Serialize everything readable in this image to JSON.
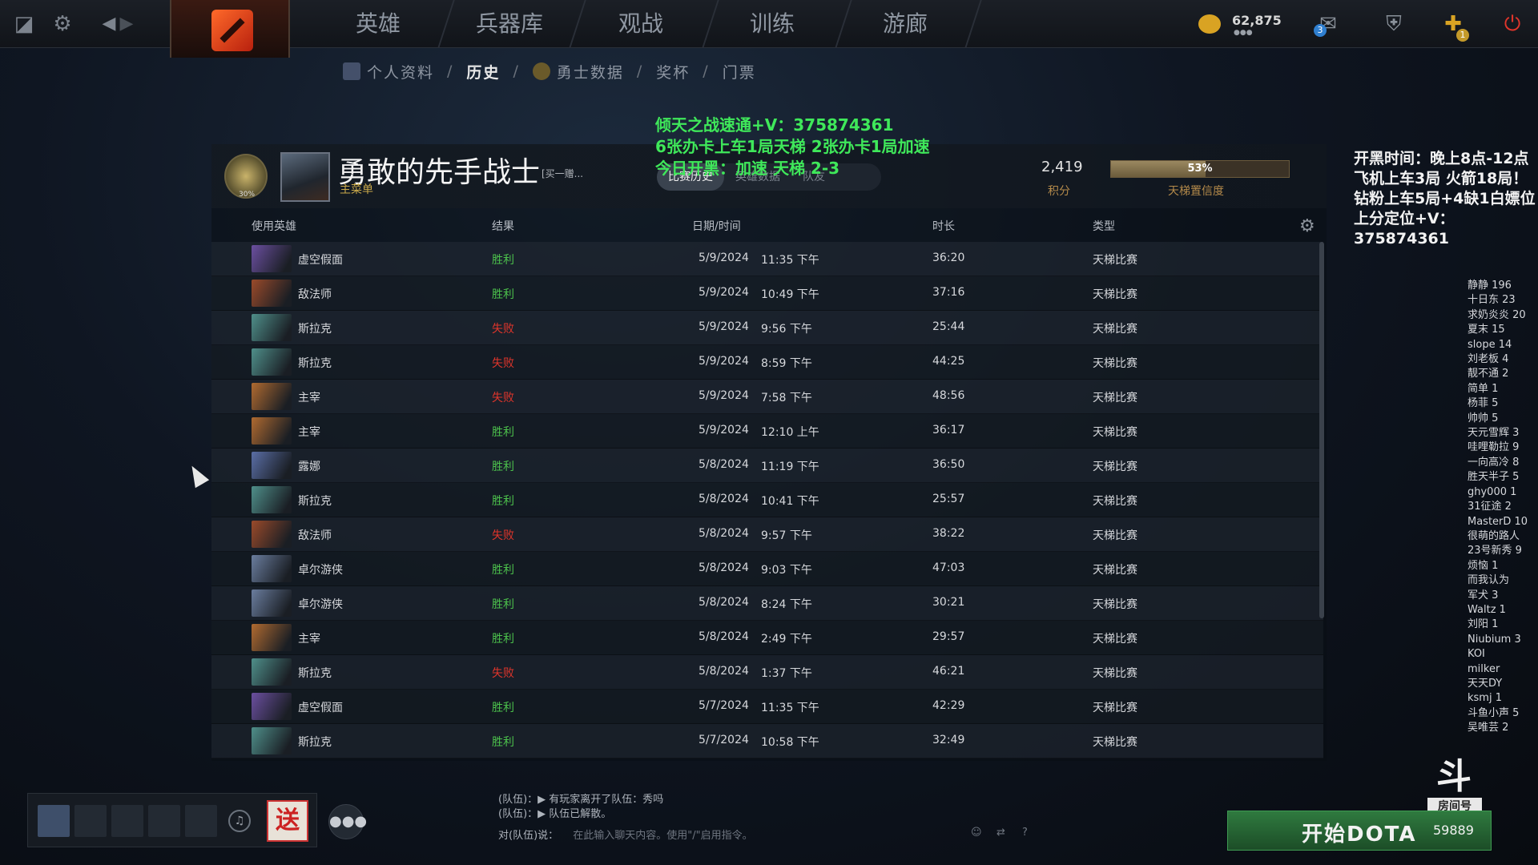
{
  "topbar": {
    "nav": [
      "英雄",
      "兵器库",
      "观战",
      "训练",
      "游廊"
    ],
    "coins": "62,875",
    "mail_badge": "3",
    "plus_badge": "1"
  },
  "breadcrumb": {
    "items": [
      "个人资料",
      "历史",
      "勇士数据",
      "奖杯",
      "门票"
    ],
    "active": "历史"
  },
  "overlay": {
    "green_lines": [
      "倾天之战速通+V：375874361",
      "6张办卡上车1局天梯  2张办卡1局加速",
      "今日开黑：加速  天梯 2-3"
    ],
    "right_lines": [
      "开黑时间：晚上8点-12点",
      "飞机上车3局  火箭18局！",
      "钻粉上车5局+4缺1白嫖位",
      "上分定位+V：375874361"
    ],
    "fans": [
      "静静 196",
      "十日东 23",
      "求奶炎炎 20",
      "夏末 15",
      "slope 14",
      "刘老板 4",
      "靓不通 2",
      "简单 1",
      "杨菲 5",
      "帅帅 5",
      "天元雪辉 3",
      "哇哩勒拉 9",
      "一向高冷 8",
      "胜天半子 5",
      "ghy000  1",
      "31征途  2",
      "MasterD 10",
      "很萌的路人",
      "23号新秀 9",
      "烦恼 1",
      "而我认为",
      "军犬 3",
      "Waltz  1",
      "刘阳 1",
      "Niubium 3",
      "KOI",
      "milker",
      "天天DY",
      "ksmj  1",
      "斗鱼小声 5",
      "吴唯芸 2"
    ]
  },
  "profile": {
    "medal_num": "30%",
    "name": "勇敢的先手战士",
    "tag": "[买一赠...",
    "subtitle": "主菜单",
    "tabs": [
      "比赛历史",
      "英雄数据",
      "队友"
    ],
    "active_tab": "比赛历史",
    "score": "2,419",
    "score_label": "积分",
    "confidence": "53%",
    "confidence_value": 0.53,
    "confidence_label": "天梯置信度"
  },
  "table": {
    "headers": [
      "使用英雄",
      "结果",
      "日期/时间",
      "时长",
      "类型"
    ],
    "rows": [
      {
        "hero": "虚空假面",
        "result": "胜利",
        "date": "5/9/2024",
        "time": "11:35 下午",
        "duration": "36:20",
        "type": "天梯比赛",
        "color": "#6b4fa0"
      },
      {
        "hero": "敌法师",
        "result": "胜利",
        "date": "5/9/2024",
        "time": "10:49 下午",
        "duration": "37:16",
        "type": "天梯比赛",
        "color": "#9a4a2a"
      },
      {
        "hero": "斯拉克",
        "result": "失败",
        "date": "5/9/2024",
        "time": "9:56 下午",
        "duration": "25:44",
        "type": "天梯比赛",
        "color": "#4f8f8a"
      },
      {
        "hero": "斯拉克",
        "result": "失败",
        "date": "5/9/2024",
        "time": "8:59 下午",
        "duration": "44:25",
        "type": "天梯比赛",
        "color": "#4f8f8a"
      },
      {
        "hero": "主宰",
        "result": "失败",
        "date": "5/9/2024",
        "time": "7:58 下午",
        "duration": "48:56",
        "type": "天梯比赛",
        "color": "#b06a30"
      },
      {
        "hero": "主宰",
        "result": "胜利",
        "date": "5/9/2024",
        "time": "12:10 上午",
        "duration": "36:17",
        "type": "天梯比赛",
        "color": "#b06a30"
      },
      {
        "hero": "露娜",
        "result": "胜利",
        "date": "5/8/2024",
        "time": "11:19 下午",
        "duration": "36:50",
        "type": "天梯比赛",
        "color": "#5a6ea6"
      },
      {
        "hero": "斯拉克",
        "result": "胜利",
        "date": "5/8/2024",
        "time": "10:41 下午",
        "duration": "25:57",
        "type": "天梯比赛",
        "color": "#4f8f8a"
      },
      {
        "hero": "敌法师",
        "result": "失败",
        "date": "5/8/2024",
        "time": "9:57 下午",
        "duration": "38:22",
        "type": "天梯比赛",
        "color": "#9a4a2a"
      },
      {
        "hero": "卓尔游侠",
        "result": "胜利",
        "date": "5/8/2024",
        "time": "9:03 下午",
        "duration": "47:03",
        "type": "天梯比赛",
        "color": "#6a7d9e"
      },
      {
        "hero": "卓尔游侠",
        "result": "胜利",
        "date": "5/8/2024",
        "time": "8:24 下午",
        "duration": "30:21",
        "type": "天梯比赛",
        "color": "#6a7d9e"
      },
      {
        "hero": "主宰",
        "result": "胜利",
        "date": "5/8/2024",
        "time": "2:49 下午",
        "duration": "29:57",
        "type": "天梯比赛",
        "color": "#b06a30"
      },
      {
        "hero": "斯拉克",
        "result": "失败",
        "date": "5/8/2024",
        "time": "1:37 下午",
        "duration": "46:21",
        "type": "天梯比赛",
        "color": "#4f8f8a"
      },
      {
        "hero": "虚空假面",
        "result": "胜利",
        "date": "5/7/2024",
        "time": "11:35 下午",
        "duration": "42:29",
        "type": "天梯比赛",
        "color": "#6b4fa0"
      },
      {
        "hero": "斯拉克",
        "result": "胜利",
        "date": "5/7/2024",
        "time": "10:58 下午",
        "duration": "32:49",
        "type": "天梯比赛",
        "color": "#4f8f8a"
      }
    ]
  },
  "chat": {
    "log": [
      "(队伍)：▶ 有玩家离开了队伍：秀吗",
      "(队伍)：▶ 队伍已解散。"
    ],
    "prefix": "对(队伍)说：",
    "placeholder": "在此输入聊天内容。使用\"/\"启用指令。"
  },
  "bottom": {
    "gift_label": "送",
    "start_label": "开始DOTA",
    "start_count": "59889",
    "room_logo": "斗鱼",
    "room_sub": "房间号"
  }
}
